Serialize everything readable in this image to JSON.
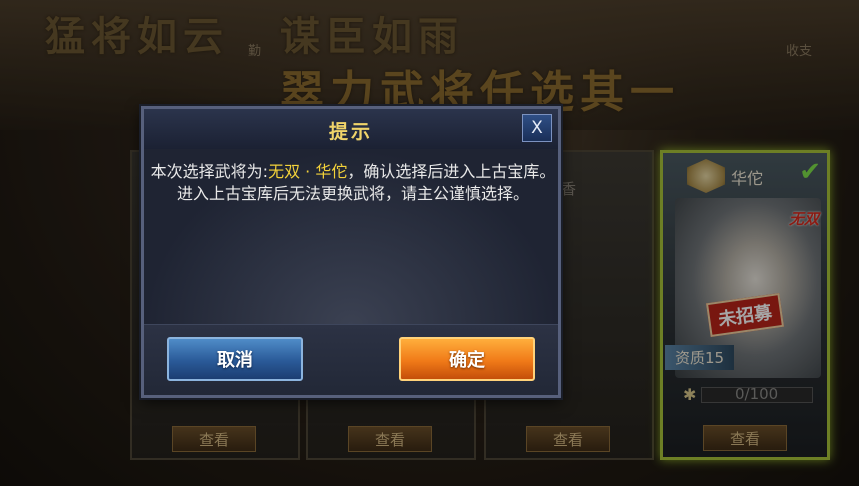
{
  "banner": {
    "slogan_left": "猛将如云",
    "slogan_right": "谋臣如雨",
    "headline": "翠力武将任选其一"
  },
  "top_icons": {
    "left": "勤",
    "right_1": "收支"
  },
  "cards": [
    {
      "name": "",
      "partial": "",
      "view_label": "查看"
    },
    {
      "name": "",
      "partial": "",
      "view_label": "查看"
    },
    {
      "name": "",
      "partial": "尚香",
      "view_label": "查看"
    },
    {
      "name": "华佗",
      "selected": true,
      "tag": "无双",
      "stamp": "未招募",
      "quality": "资质15",
      "progress_text": "0/100",
      "progress_fraction": 0,
      "view_label": "查看"
    }
  ],
  "dialog": {
    "title": "提示",
    "close_label": "X",
    "message_pre": "本次选择武将为:",
    "message_highlight": "无双 · 华佗",
    "message_post": "，确认选择后进入上古宝库。进入上古宝库后无法更换武将，请主公谨慎选择。",
    "cancel_label": "取消",
    "confirm_label": "确定"
  },
  "colors": {
    "highlight": "#f3d23a",
    "selected_border": "#a8c43a",
    "confirm": "#f07a18",
    "cancel": "#2a5a98"
  }
}
